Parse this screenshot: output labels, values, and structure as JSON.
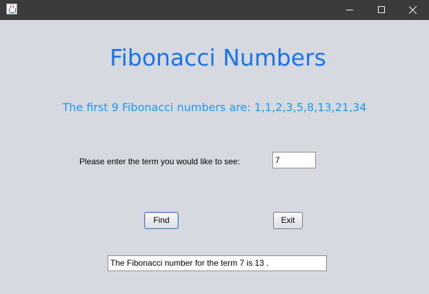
{
  "window": {
    "icon": "java-cup-icon",
    "controls": {
      "minimize_icon": "minimize-icon",
      "maximize_icon": "maximize-icon",
      "close_icon": "close-icon"
    }
  },
  "main": {
    "heading": "Fibonacci Numbers",
    "subheading": "The first 9 Fibonacci numbers are: 1,1,2,3,5,8,13,21,34",
    "prompt_label": "Please enter the term you would like to see:",
    "term_input_value": "7",
    "find_button_label": "Find",
    "exit_button_label": "Exit",
    "result_text": "The Fibonacci number for the term 7 is 13 ."
  },
  "colors": {
    "titlebar": "#3b3b3b",
    "background": "#d6d9df",
    "heading": "#1a73e8",
    "subheading": "#1b9af2"
  }
}
